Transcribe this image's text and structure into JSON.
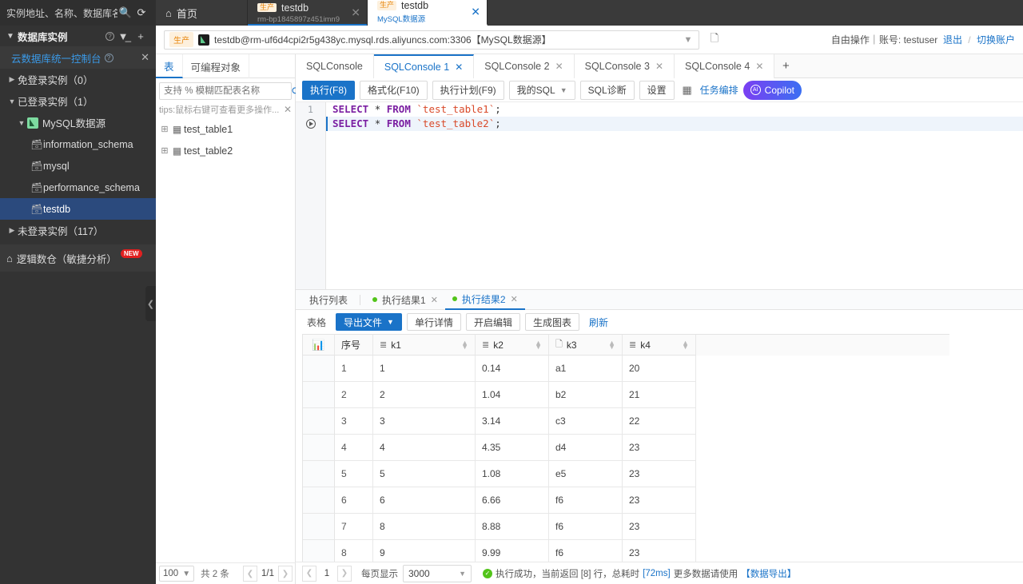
{
  "topbar": {
    "search_placeholder": "实例地址、名称、数据库名",
    "search_icon": "search-icon",
    "refresh_icon": "refresh-icon",
    "home_tab": {
      "label": "首页",
      "icon": "home-icon"
    },
    "tabs": [
      {
        "badge": "生产",
        "name": "testdb",
        "sub": "rm-bp1845897z451imn9",
        "active": false
      },
      {
        "badge": "生产",
        "name": "testdb",
        "sub": "MySQL数据源",
        "active": true
      }
    ]
  },
  "sidebar": {
    "title": "数据库实例",
    "help_icon": "help-icon",
    "filter_icon": "filter-icon",
    "add_icon": "plus-icon",
    "console_link": "云数据库统一控制台",
    "close_icon": "close-icon",
    "groups": [
      {
        "label": "免登录实例（0）",
        "expanded": false
      },
      {
        "label": "已登录实例（1）",
        "expanded": true
      }
    ],
    "datasource": "MySQL数据源",
    "databases": [
      {
        "label": "information_schema",
        "selected": false
      },
      {
        "label": "mysql",
        "selected": false
      },
      {
        "label": "performance_schema",
        "selected": false
      },
      {
        "label": "testdb",
        "selected": true
      }
    ],
    "unlogged": "未登录实例（117）",
    "footer": {
      "label": "逻辑数仓（敏捷分析）",
      "badge": "NEW",
      "icon": "warehouse-icon"
    },
    "collapse_icon": "chevron-left-icon"
  },
  "connbar": {
    "tag": "生产",
    "db_icon": "mysql-datasource-icon",
    "connection": "testdb@rm-uf6d4cpi2r5g438yc.mysql.rds.aliyuncs.com:3306【MySQL数据源】",
    "caret_icon": "chevron-down-icon",
    "copy_icon": "copy-icon",
    "account_prefix": "自由操作｜账号: testuser",
    "logout": "退出",
    "separator": "/",
    "switch_account": "切换账户"
  },
  "objpanel": {
    "tabs": [
      {
        "label": "表",
        "active": true
      },
      {
        "label": "可编程对象",
        "active": false
      }
    ],
    "search_placeholder": "支持 % 模糊匹配表名称",
    "refresh_icon": "refresh-icon",
    "menu_icon": "list-settings-icon",
    "tip": "tips:鼠标右键可查看更多操作...",
    "tip_close_icon": "close-icon",
    "tables": [
      "test_table1",
      "test_table2"
    ],
    "page_size": "100",
    "total": "共 2 条",
    "page_indicator": "1/1",
    "prev_icon": "chevron-left-icon",
    "next_icon": "chevron-right-icon"
  },
  "console": {
    "tabs": [
      {
        "label": "SQLConsole",
        "active": false,
        "closable": false
      },
      {
        "label": "SQLConsole 1",
        "active": true,
        "closable": true
      },
      {
        "label": "SQLConsole 2",
        "active": false,
        "closable": true
      },
      {
        "label": "SQLConsole 3",
        "active": false,
        "closable": true
      },
      {
        "label": "SQLConsole 4",
        "active": false,
        "closable": true
      }
    ],
    "add_tab_icon": "plus-icon",
    "toolbar": {
      "execute": "执行(F8)",
      "format": "格式化(F10)",
      "plan": "执行计划(F9)",
      "my_sql": "我的SQL",
      "diagnose": "SQL诊断",
      "settings": "设置",
      "panel_icon": "panel-icon",
      "task_orchestration": "任务编排",
      "copilot": "Copilot",
      "copilot_icon": "ai-icon"
    },
    "editor": {
      "lines": [
        {
          "gutter": "1",
          "keyword": "SELECT",
          "star": "*",
          "from": "FROM",
          "table": "`test_table1`",
          "end": ";",
          "current": false
        },
        {
          "gutter": "run",
          "keyword": "SELECT",
          "star": "*",
          "from": "FROM",
          "table": "`test_table2`",
          "end": ";",
          "current": true
        }
      ]
    }
  },
  "result": {
    "tabs": [
      {
        "label": "执行列表",
        "dot": false,
        "active": false,
        "closable": false
      },
      {
        "label": "执行结果1",
        "dot": true,
        "active": false,
        "closable": true
      },
      {
        "label": "执行结果2",
        "dot": true,
        "active": true,
        "closable": true
      }
    ],
    "toolbar": {
      "grid": "表格",
      "export": "导出文件",
      "row_detail": "单行详情",
      "enable_edit": "开启编辑",
      "gen_chart": "生成图表",
      "refresh": "刷新",
      "caret_icon": "chevron-down-icon"
    },
    "table": {
      "chart_icon": "bar-chart-icon",
      "columns": [
        {
          "label": "序号",
          "icon": null,
          "sortable": false
        },
        {
          "label": "k1",
          "icon": "number-column-icon",
          "sortable": true
        },
        {
          "label": "k2",
          "icon": "number-column-icon",
          "sortable": true
        },
        {
          "label": "k3",
          "icon": "text-column-icon",
          "sortable": true
        },
        {
          "label": "k4",
          "icon": "number-column-icon",
          "sortable": true
        }
      ],
      "rows": [
        {
          "idx": "1",
          "k1": "1",
          "k2": "0.14",
          "k3": "a1",
          "k4": "20"
        },
        {
          "idx": "2",
          "k1": "2",
          "k2": "1.04",
          "k3": "b2",
          "k4": "21"
        },
        {
          "idx": "3",
          "k1": "3",
          "k2": "3.14",
          "k3": "c3",
          "k4": "22"
        },
        {
          "idx": "4",
          "k1": "4",
          "k2": "4.35",
          "k3": "d4",
          "k4": "23"
        },
        {
          "idx": "5",
          "k1": "5",
          "k2": "1.08",
          "k3": "e5",
          "k4": "23"
        },
        {
          "idx": "6",
          "k1": "6",
          "k2": "6.66",
          "k3": "f6",
          "k4": "23"
        },
        {
          "idx": "7",
          "k1": "8",
          "k2": "8.88",
          "k3": "f6",
          "k4": "23"
        },
        {
          "idx": "8",
          "k1": "9",
          "k2": "9.99",
          "k3": "f6",
          "k4": "23"
        }
      ]
    },
    "footer": {
      "prev_icon": "chevron-left-icon",
      "page": "1",
      "next_icon": "chevron-right-icon",
      "per_page_label": "每页显示",
      "per_page_value": "3000",
      "caret_icon": "chevron-down-icon",
      "status_icon": "success-icon",
      "status_a": "执行成功，当前返回 [8] 行，总耗时 ",
      "status_time": "[72ms]",
      "status_b": "更多数据请使用",
      "status_link": "【数据导出】"
    }
  }
}
